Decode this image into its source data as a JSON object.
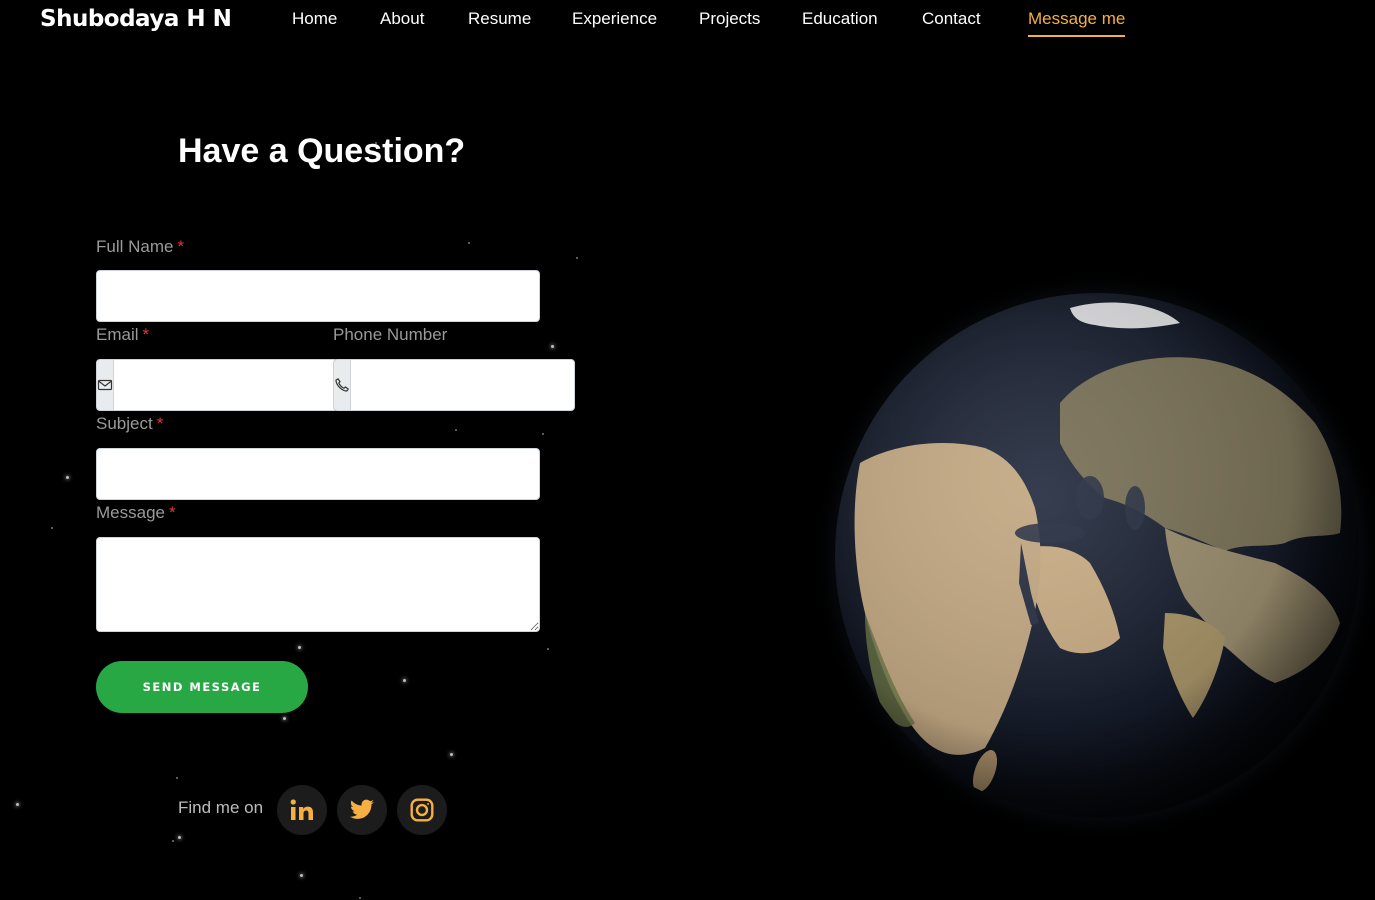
{
  "brand": "Shubodaya H N",
  "nav": {
    "items": [
      {
        "label": "Home"
      },
      {
        "label": "About"
      },
      {
        "label": "Resume"
      },
      {
        "label": "Experience"
      },
      {
        "label": "Projects"
      },
      {
        "label": "Education"
      },
      {
        "label": "Contact"
      },
      {
        "label": "Message me"
      }
    ],
    "active_index": 7
  },
  "form": {
    "heading": "Have a Question?",
    "full_name_label": "Full Name",
    "email_label": "Email",
    "phone_label": "Phone Number",
    "subject_label": "Subject",
    "message_label": "Message",
    "required_mark": "*",
    "full_name_value": "",
    "email_value": "",
    "phone_value": "",
    "subject_value": "",
    "message_value": "",
    "send_label": "SEND MESSAGE"
  },
  "social": {
    "label": "Find me on",
    "links": [
      {
        "icon": "linkedin-icon"
      },
      {
        "icon": "twitter-icon"
      },
      {
        "icon": "instagram-icon"
      }
    ]
  },
  "colors": {
    "background": "#000000",
    "accent": "#f5b041",
    "send_button": "#28a745",
    "required": "#e53935"
  }
}
